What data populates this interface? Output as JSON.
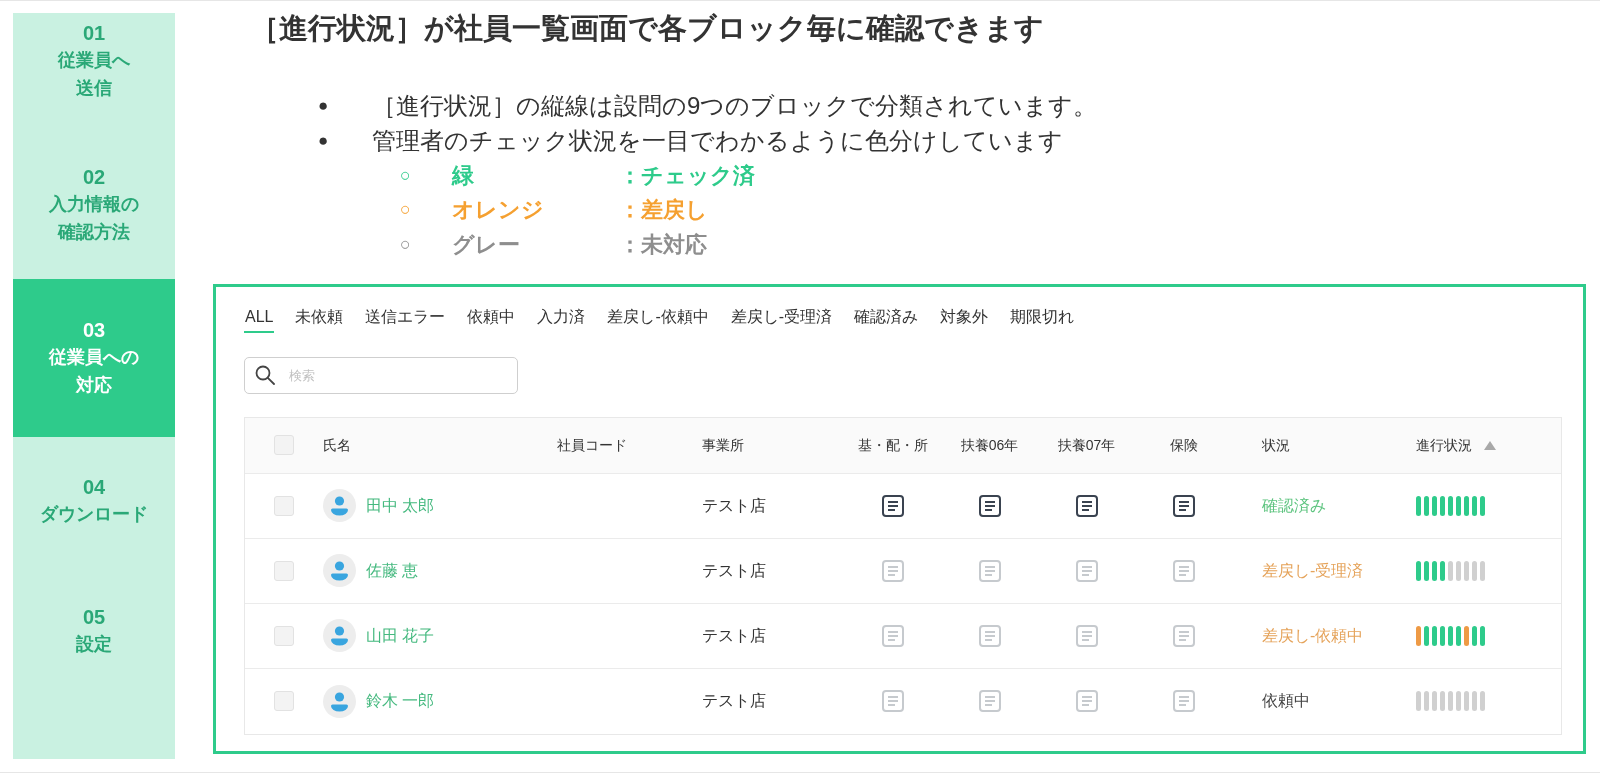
{
  "sidebar": {
    "items": [
      {
        "number": "01",
        "lines": [
          "従業員へ",
          "送信"
        ],
        "selected": false
      },
      {
        "number": "02",
        "lines": [
          "入力情報の",
          "確認方法"
        ],
        "selected": false
      },
      {
        "number": "03",
        "lines": [
          "従業員への",
          "対応"
        ],
        "selected": true
      },
      {
        "number": "04",
        "lines": [
          "ダウンロード"
        ],
        "selected": false
      },
      {
        "number": "05",
        "lines": [
          "設定"
        ],
        "selected": false
      }
    ]
  },
  "title": "［進行状況］が社員一覧画面で各ブロック毎に確認できます",
  "bullets": [
    {
      "marker": "●",
      "text": "［進行状況］の縦線は設問の9つのブロックで分類されています。"
    },
    {
      "marker": "●",
      "text": "管理者のチェック状況を一目でわかるように色分けしています"
    }
  ],
  "legend": [
    {
      "marker": "○",
      "label": "緑",
      "description": "：チェック済",
      "color": "#2ecb8b"
    },
    {
      "marker": "○",
      "label": "オレンジ",
      "description": "：差戻し",
      "color": "#f5a030"
    },
    {
      "marker": "○",
      "label": "グレー",
      "description": "：未対応",
      "color": "#8e8e8e"
    }
  ],
  "panel": {
    "tabs": [
      {
        "label": "ALL",
        "selected": true
      },
      {
        "label": "未依頼",
        "selected": false
      },
      {
        "label": "送信エラー",
        "selected": false
      },
      {
        "label": "依頼中",
        "selected": false
      },
      {
        "label": "入力済",
        "selected": false
      },
      {
        "label": "差戻し-依頼中",
        "selected": false
      },
      {
        "label": "差戻し-受理済",
        "selected": false
      },
      {
        "label": "確認済み",
        "selected": false
      },
      {
        "label": "対象外",
        "selected": false
      },
      {
        "label": "期限切れ",
        "selected": false
      }
    ],
    "search": {
      "placeholder": "検索"
    },
    "table": {
      "header_checkbox": {
        "checked": false
      },
      "columns": [
        {
          "label": "氏名",
          "sorted": false
        },
        {
          "label": "社員コード",
          "sorted": false
        },
        {
          "label": "事業所",
          "sorted": false
        },
        {
          "label": "基・配・所",
          "sorted": false
        },
        {
          "label": "扶養06年",
          "sorted": false
        },
        {
          "label": "扶養07年",
          "sorted": false
        },
        {
          "label": "保険",
          "sorted": false
        },
        {
          "label": "状況",
          "sorted": false
        },
        {
          "label": "進行状況",
          "sorted": true
        }
      ],
      "rows": [
        {
          "checked": false,
          "name": "田中 太郎",
          "office": "テスト店",
          "documents": [
            {
              "disabled": false
            },
            {
              "disabled": false
            },
            {
              "disabled": false
            },
            {
              "disabled": false
            }
          ],
          "status": {
            "text": "確認済み",
            "color": "#5dc47f"
          },
          "progress": [
            {
              "color": "#2ecb8b"
            },
            {
              "color": "#2ecb8b"
            },
            {
              "color": "#2ecb8b"
            },
            {
              "color": "#2ecb8b"
            },
            {
              "color": "#2ecb8b"
            },
            {
              "color": "#2ecb8b"
            },
            {
              "color": "#2ecb8b"
            },
            {
              "color": "#2ecb8b"
            },
            {
              "color": "#2ecb8b"
            }
          ]
        },
        {
          "checked": false,
          "name": "佐藤 恵",
          "office": "テスト店",
          "documents": [
            {
              "disabled": true
            },
            {
              "disabled": true
            },
            {
              "disabled": true
            },
            {
              "disabled": true
            }
          ],
          "status": {
            "text": "差戻し-受理済",
            "color": "#e5a35a"
          },
          "progress": [
            {
              "color": "#2ecb8b"
            },
            {
              "color": "#2ecb8b"
            },
            {
              "color": "#2ecb8b"
            },
            {
              "color": "#2ecb8b"
            },
            {
              "color": "#d0d0d0"
            },
            {
              "color": "#d0d0d0"
            },
            {
              "color": "#d0d0d0"
            },
            {
              "color": "#d0d0d0"
            },
            {
              "color": "#d0d0d0"
            }
          ]
        },
        {
          "checked": false,
          "name": "山田 花子",
          "office": "テスト店",
          "documents": [
            {
              "disabled": true
            },
            {
              "disabled": true
            },
            {
              "disabled": true
            },
            {
              "disabled": true
            }
          ],
          "status": {
            "text": "差戻し-依頼中",
            "color": "#e5a35a"
          },
          "progress": [
            {
              "color": "#ee9a45"
            },
            {
              "color": "#2ecb8b"
            },
            {
              "color": "#2ecb8b"
            },
            {
              "color": "#2ecb8b"
            },
            {
              "color": "#2ecb8b"
            },
            {
              "color": "#2ecb8b"
            },
            {
              "color": "#ee9a45"
            },
            {
              "color": "#2ecb8b"
            },
            {
              "color": "#2ecb8b"
            }
          ]
        },
        {
          "checked": false,
          "name": "鈴木 一郎",
          "office": "テスト店",
          "documents": [
            {
              "disabled": true
            },
            {
              "disabled": true
            },
            {
              "disabled": true
            },
            {
              "disabled": true
            }
          ],
          "status": {
            "text": "依頼中",
            "color": "#444444"
          },
          "progress": [
            {
              "color": "#d0d0d0"
            },
            {
              "color": "#d0d0d0"
            },
            {
              "color": "#d0d0d0"
            },
            {
              "color": "#d0d0d0"
            },
            {
              "color": "#d0d0d0"
            },
            {
              "color": "#d0d0d0"
            },
            {
              "color": "#d0d0d0"
            },
            {
              "color": "#d0d0d0"
            },
            {
              "color": "#d0d0d0"
            }
          ]
        }
      ]
    }
  }
}
